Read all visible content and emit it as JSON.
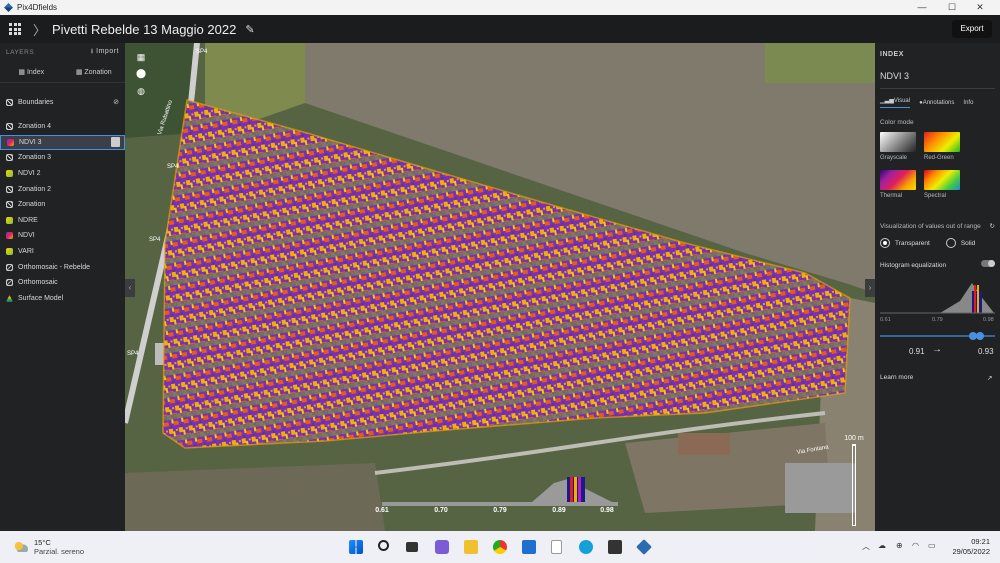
{
  "window": {
    "app_name": "Pix4Dfields",
    "min": "—",
    "max": "☐",
    "close": "✕"
  },
  "header": {
    "separator": "〉",
    "project_title": "Pivetti  Rebelde 13 Maggio 2022",
    "export_label": "Export"
  },
  "left": {
    "layers_heading": "LAYERS",
    "import_label": "Import",
    "tabs": [
      {
        "label": "Index"
      },
      {
        "label": "Zonation"
      }
    ],
    "boundaries_label": "Boundaries",
    "items": [
      {
        "label": "Zonation 4",
        "icon": "zonation-icon"
      },
      {
        "label": "NDVI 3",
        "icon": "index-icon",
        "selected": true
      },
      {
        "label": "Zonation 3",
        "icon": "zonation-icon"
      },
      {
        "label": "NDVI 2",
        "icon": "leaf-icon"
      },
      {
        "label": "Zonation 2",
        "icon": "zonation-icon"
      },
      {
        "label": "Zonation",
        "icon": "zonation-icon"
      },
      {
        "label": "NDRE",
        "icon": "leaf-icon"
      },
      {
        "label": "NDVI",
        "icon": "index-icon"
      },
      {
        "label": "VARI",
        "icon": "leaf-icon"
      },
      {
        "label": "Orthomosaic - Rebelde",
        "icon": "orthomosaic-icon"
      },
      {
        "label": "Orthomosaic",
        "icon": "orthomosaic-icon"
      },
      {
        "label": "Surface Model",
        "icon": "surface-icon"
      }
    ]
  },
  "map": {
    "road_labels": [
      "SP4",
      "SP4",
      "SP4",
      "SP4",
      "Via Rubattino",
      "Via Fontana"
    ],
    "scale_label": "100 m",
    "legend_ticks": [
      "0.61",
      "0.70",
      "0.79",
      "0.89",
      "0.98"
    ]
  },
  "right": {
    "heading": "INDEX",
    "index_name": "NDVI 3",
    "tabs": [
      {
        "label": "Visual"
      },
      {
        "label": "Annotations"
      },
      {
        "label": "Info"
      }
    ],
    "color_mode_label": "Color mode",
    "color_modes": [
      {
        "label": "Grayscale"
      },
      {
        "label": "Red-Green"
      },
      {
        "label": "Thermal"
      },
      {
        "label": "Spectral"
      }
    ],
    "out_of_range_label": "Visualization of values out of range",
    "radio_transparent": "Transparent",
    "radio_solid": "Solid",
    "histogram_eq_label": "Histogram equalization",
    "hist_ticks": [
      "0.61",
      "0.79",
      "0.98"
    ],
    "range_min": "0.91",
    "range_arrow": "→",
    "range_max": "0.93",
    "learn_more": "Learn more",
    "learn_arrow": "↗"
  },
  "taskbar": {
    "temperature": "15°C",
    "weather_text": "Parzial. sereno",
    "time": "09:21",
    "date": "29/05/2022",
    "chevron": "︿"
  }
}
